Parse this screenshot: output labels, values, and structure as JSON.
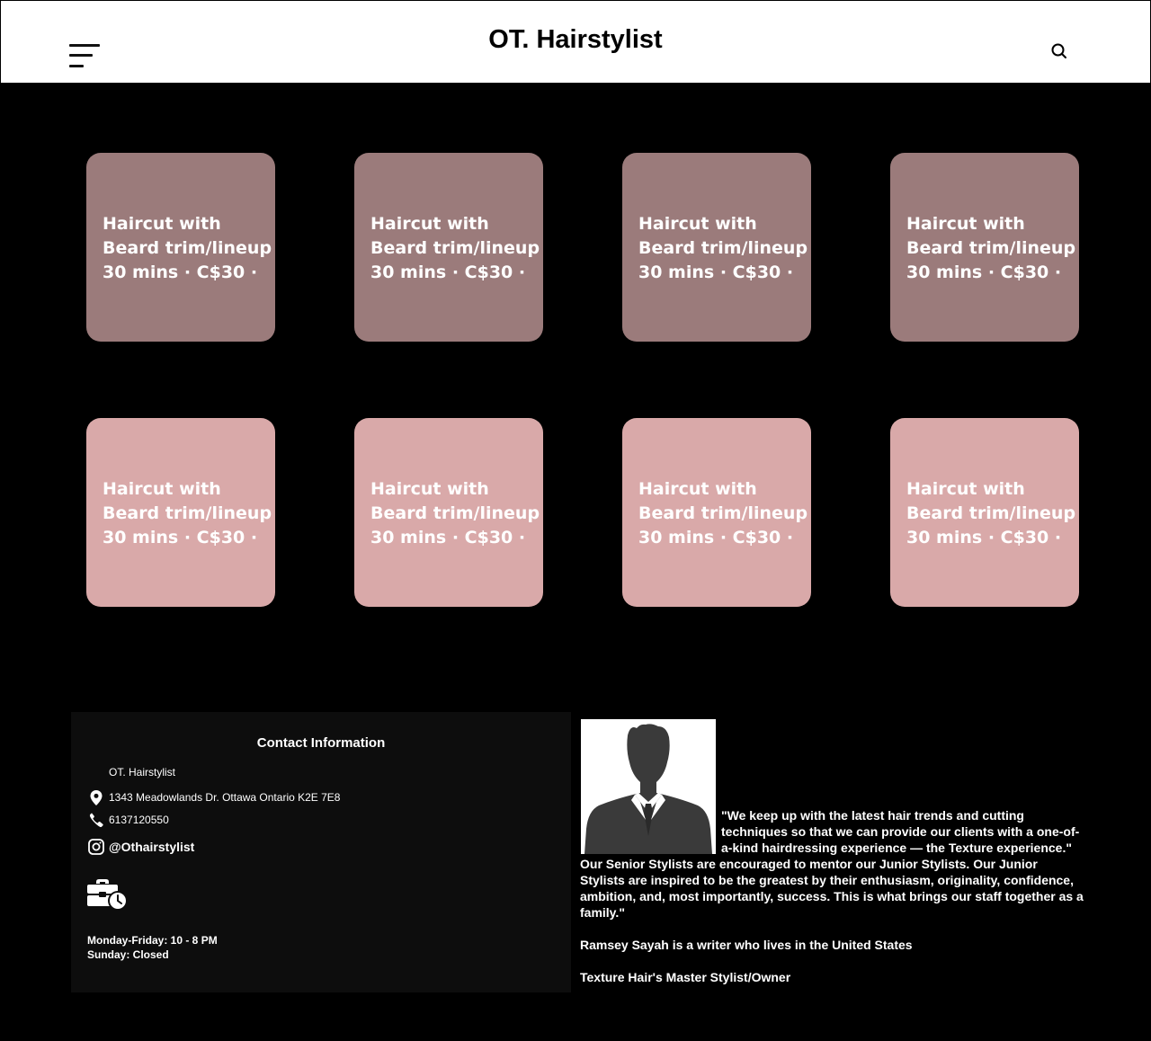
{
  "header": {
    "title": "OT. Hairstylist",
    "menu_icon": "hamburger-menu-icon",
    "search_icon": "search-icon"
  },
  "services": {
    "row1_color": "#9b7b7b",
    "row2_color": "#d9a9a9",
    "cards": [
      {
        "line1": "Haircut with",
        "line2": "Beard trim/lineup",
        "line3": "30 mins · C$30 ·"
      },
      {
        "line1": "Haircut with",
        "line2": "Beard trim/lineup",
        "line3": "30 mins · C$30 ·"
      },
      {
        "line1": "Haircut with",
        "line2": "Beard trim/lineup",
        "line3": "30 mins · C$30 ·"
      },
      {
        "line1": "Haircut with",
        "line2": "Beard trim/lineup",
        "line3": "30 mins · C$30 ·"
      },
      {
        "line1": "Haircut with",
        "line2": "Beard trim/lineup",
        "line3": "30 mins · C$30 ·"
      },
      {
        "line1": "Haircut with",
        "line2": "Beard trim/lineup",
        "line3": "30 mins · C$30 ·"
      },
      {
        "line1": "Haircut with",
        "line2": "Beard trim/lineup",
        "line3": "30 mins · C$30 ·"
      },
      {
        "line1": "Haircut with",
        "line2": "Beard trim/lineup",
        "line3": "30 mins · C$30 ·"
      }
    ]
  },
  "contact": {
    "title": "Contact Information",
    "business_name": "OT. Hairstylist",
    "address": "1343 Meadowlands Dr. Ottawa Ontario K2E 7E8",
    "address_icon": "map-pin-icon",
    "phone": "6137120550",
    "phone_icon": "phone-icon",
    "instagram": "@Othairstylist",
    "instagram_icon": "instagram-icon",
    "hours_icon": "briefcase-clock-icon",
    "hours_weekday": "Monday-Friday: 10 - 8 PM",
    "hours_sunday": "Sunday: Closed"
  },
  "about": {
    "portrait_icon": "person-silhouette-icon",
    "quote": "\"We keep up with the latest hair trends and cutting techniques so that we can provide our clients with a one-of-a-kind hairdressing experience — the Texture experience.\"",
    "paragraph": "Our Senior Stylists are encouraged to mentor our Junior Stylists. Our Junior Stylists are inspired to be the greatest by their enthusiasm, originality, confidence, ambition, and, most importantly, success. This is what brings our staff together as a family.\"",
    "author_line": "Ramsey Sayah is a writer who lives in the United States",
    "role_line": "Texture Hair's Master Stylist/Owner"
  }
}
